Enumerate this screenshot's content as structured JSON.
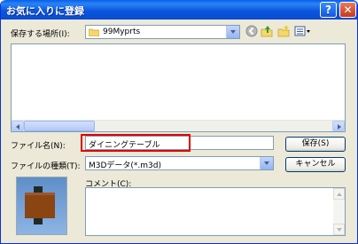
{
  "window": {
    "title": "お気に入りに登録",
    "help_glyph": "?",
    "close_glyph": "✕"
  },
  "save_location": {
    "label": "保存する場所(I):",
    "folder": "99Myprts",
    "folder_icon": "folder-icon",
    "nav_icons": [
      "back-icon",
      "up-folder-icon",
      "new-folder-icon",
      "view-menu-icon"
    ]
  },
  "file_name": {
    "label": "ファイル名(N):",
    "value": "ダイニングテーブル",
    "highlight_color": "#e00000"
  },
  "file_type": {
    "label": "ファイルの種類(T):",
    "value": "M3Dデータ(*.m3d)"
  },
  "buttons": {
    "save": "保存(S)",
    "cancel": "キャンセル"
  },
  "comment": {
    "label": "コメント(C):",
    "value": ""
  },
  "colors": {
    "titlebar": "#0a5fe8",
    "dialog_bg": "#ece9d8",
    "preview_bg": "#6f9fd8",
    "table_brown": "#8b4513"
  }
}
